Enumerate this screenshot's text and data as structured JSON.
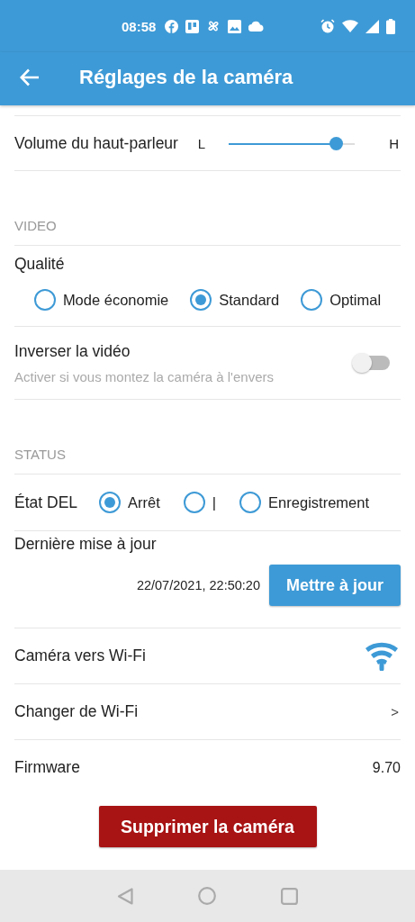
{
  "status_bar": {
    "time": "08:58"
  },
  "app_bar": {
    "title": "Réglages de la caméra"
  },
  "rows": [
    {
      "kind": "slider",
      "label": "Volume du haut-parleur",
      "min_label": "L",
      "max_label": "H",
      "level": 0.85
    },
    {
      "kind": "header",
      "label": "VIDEO"
    },
    {
      "kind": "radio_block",
      "label": "Qualité",
      "options": [
        {
          "label": "Mode économie",
          "selected": false
        },
        {
          "label": "Standard",
          "selected": true
        },
        {
          "label": "Optimal",
          "selected": false
        }
      ]
    },
    {
      "kind": "switch",
      "label": "Inverser la vidéo",
      "hint": "Activer si vous montez la caméra à l'envers",
      "on": false
    },
    {
      "kind": "header",
      "label": "STATUS"
    },
    {
      "kind": "radio_inline",
      "label": "État DEL",
      "options": [
        {
          "label": "Arrêt",
          "selected": true
        },
        {
          "label": "|",
          "selected": false
        },
        {
          "label": "Enregistrement",
          "selected": false
        }
      ]
    },
    {
      "kind": "update",
      "label": "Dernière mise à jour",
      "value": "22/07/2021, 22:50:20",
      "button": "Mettre à jour"
    },
    {
      "kind": "wifi",
      "label": "Caméra vers Wi-Fi"
    },
    {
      "kind": "link",
      "label": "Changer de Wi-Fi",
      "chevron": ">"
    },
    {
      "kind": "value",
      "label": "Firmware",
      "value": "9.70"
    }
  ],
  "delete_button": "Supprimer la caméra"
}
